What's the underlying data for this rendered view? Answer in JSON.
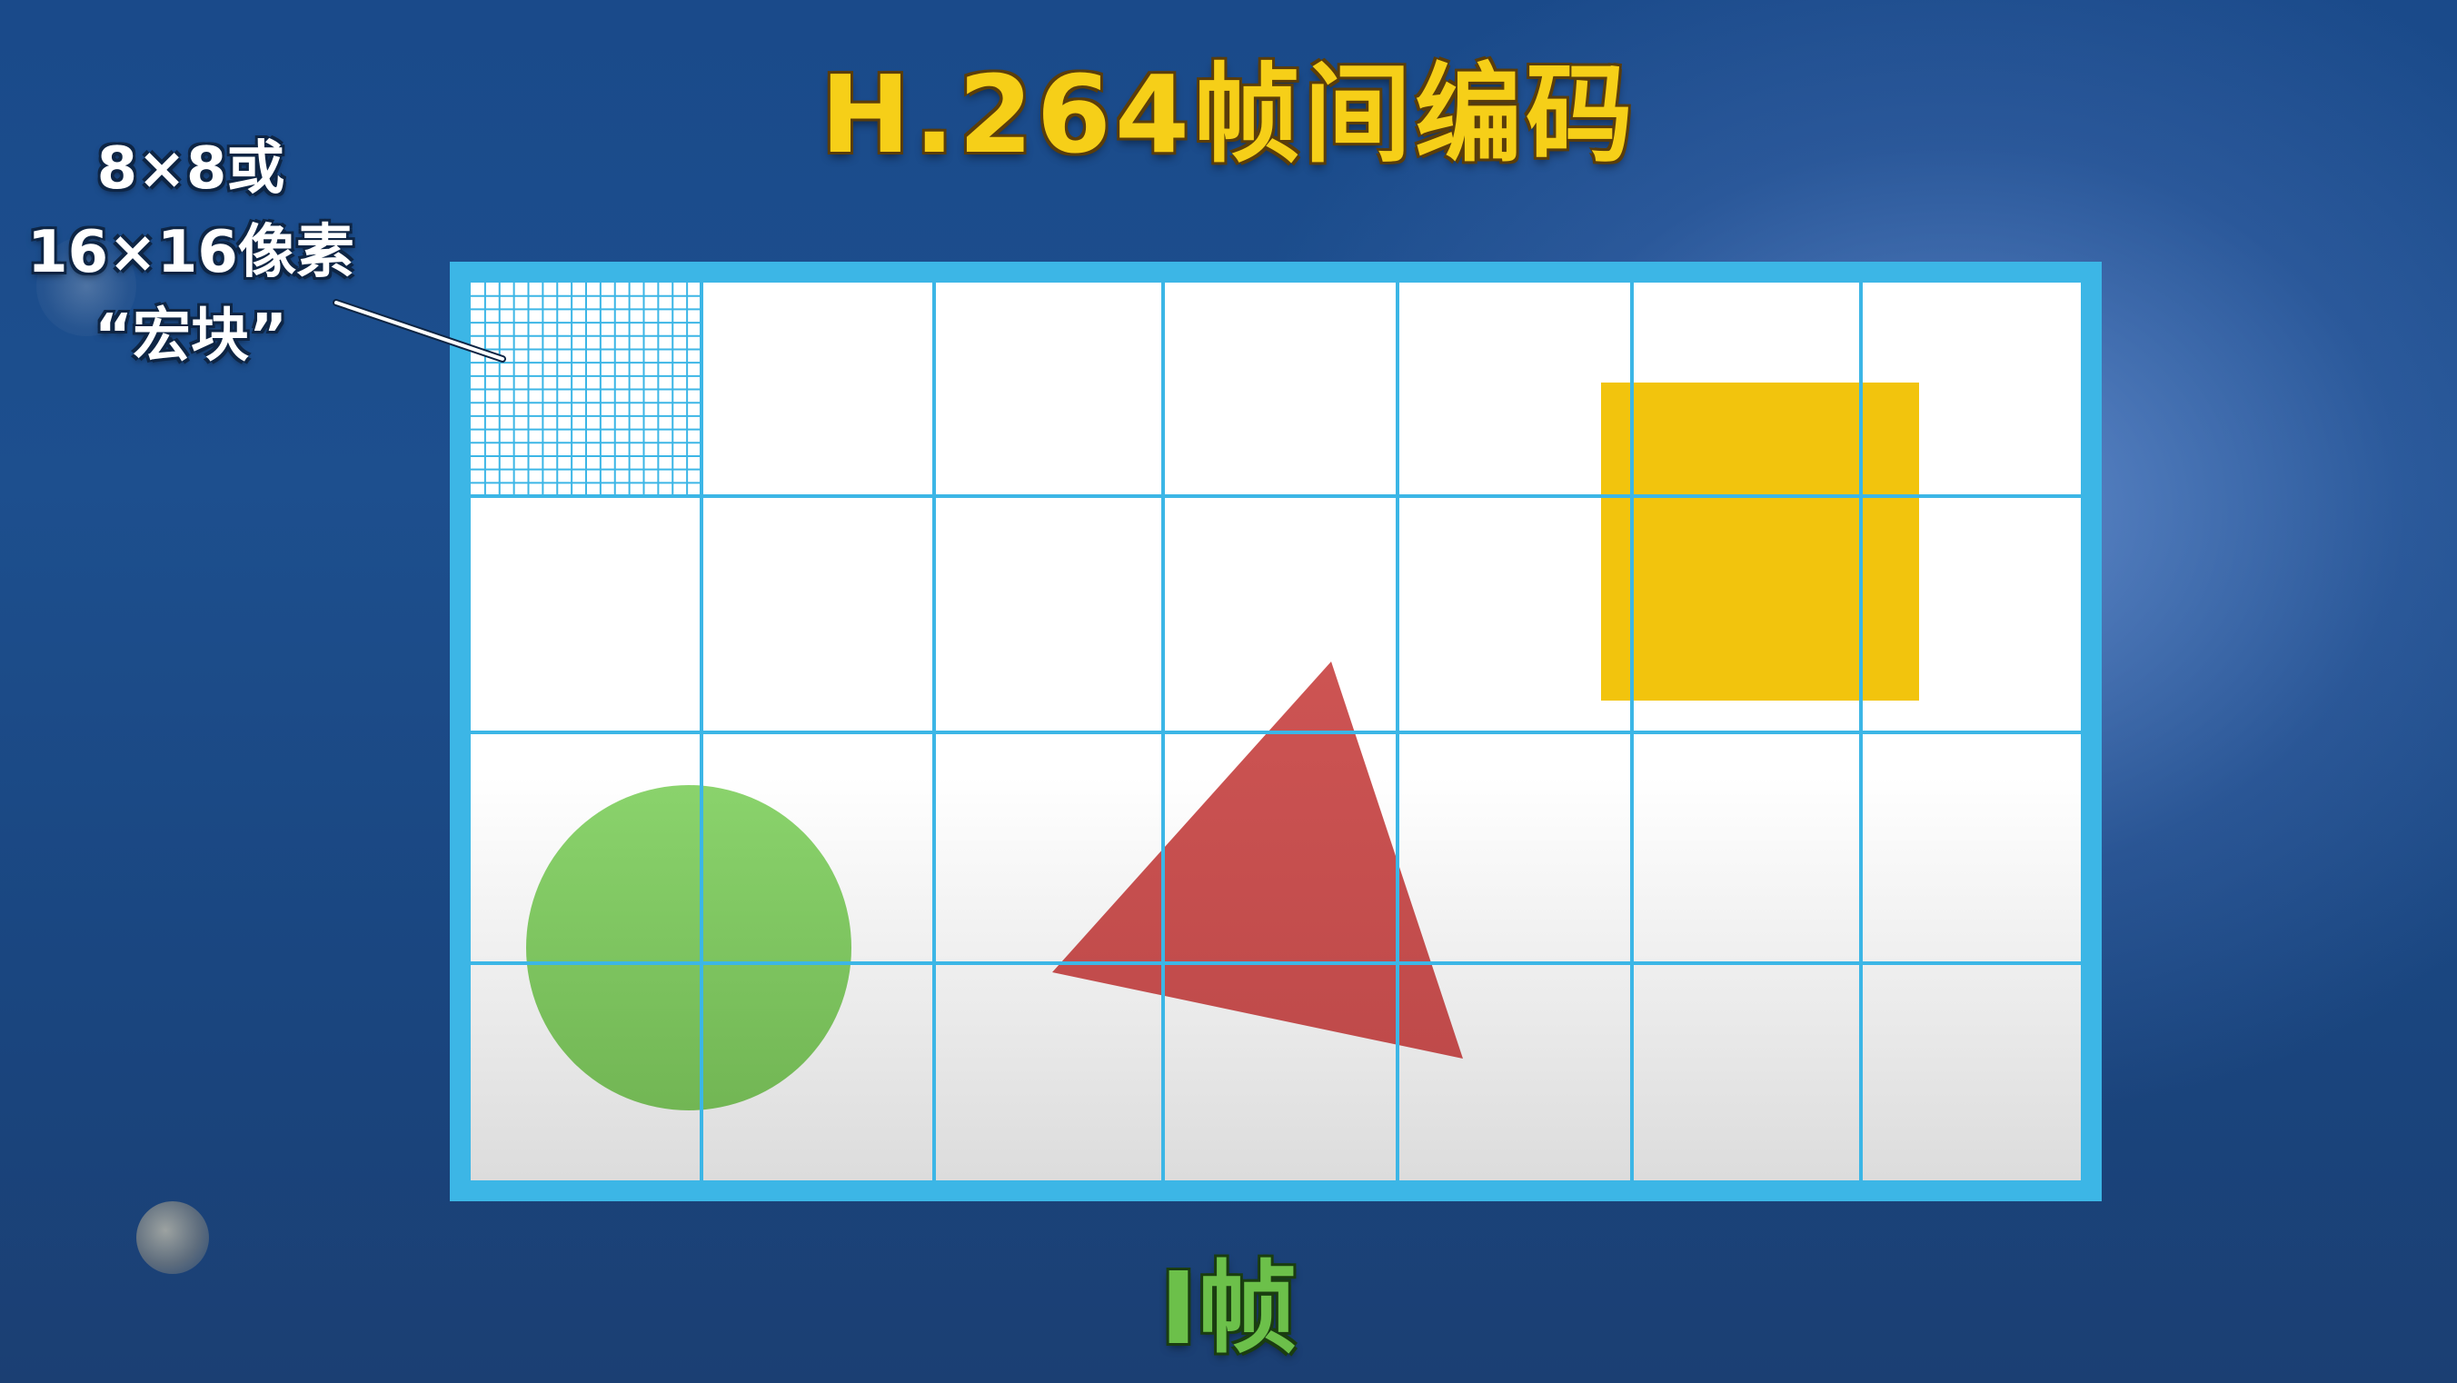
{
  "title": "H.264帧间编码",
  "annotation": {
    "line1": "8×8或",
    "line2": "16×16像素",
    "line3": "“宏块”"
  },
  "frame_label": "I帧",
  "colors": {
    "title": "#f6cf18",
    "frame_border": "#3cb6e6",
    "grid": "#3cb6e6",
    "square": "#f2c40d",
    "triangle": "#c9504f",
    "circle": "#7ec85f",
    "frame_label": "#6cc04a"
  },
  "frame": {
    "columns": 7,
    "rows": 4,
    "shapes": [
      "yellow-square",
      "red-triangle",
      "green-circle"
    ],
    "fine_grid": "top-left macroblock"
  }
}
